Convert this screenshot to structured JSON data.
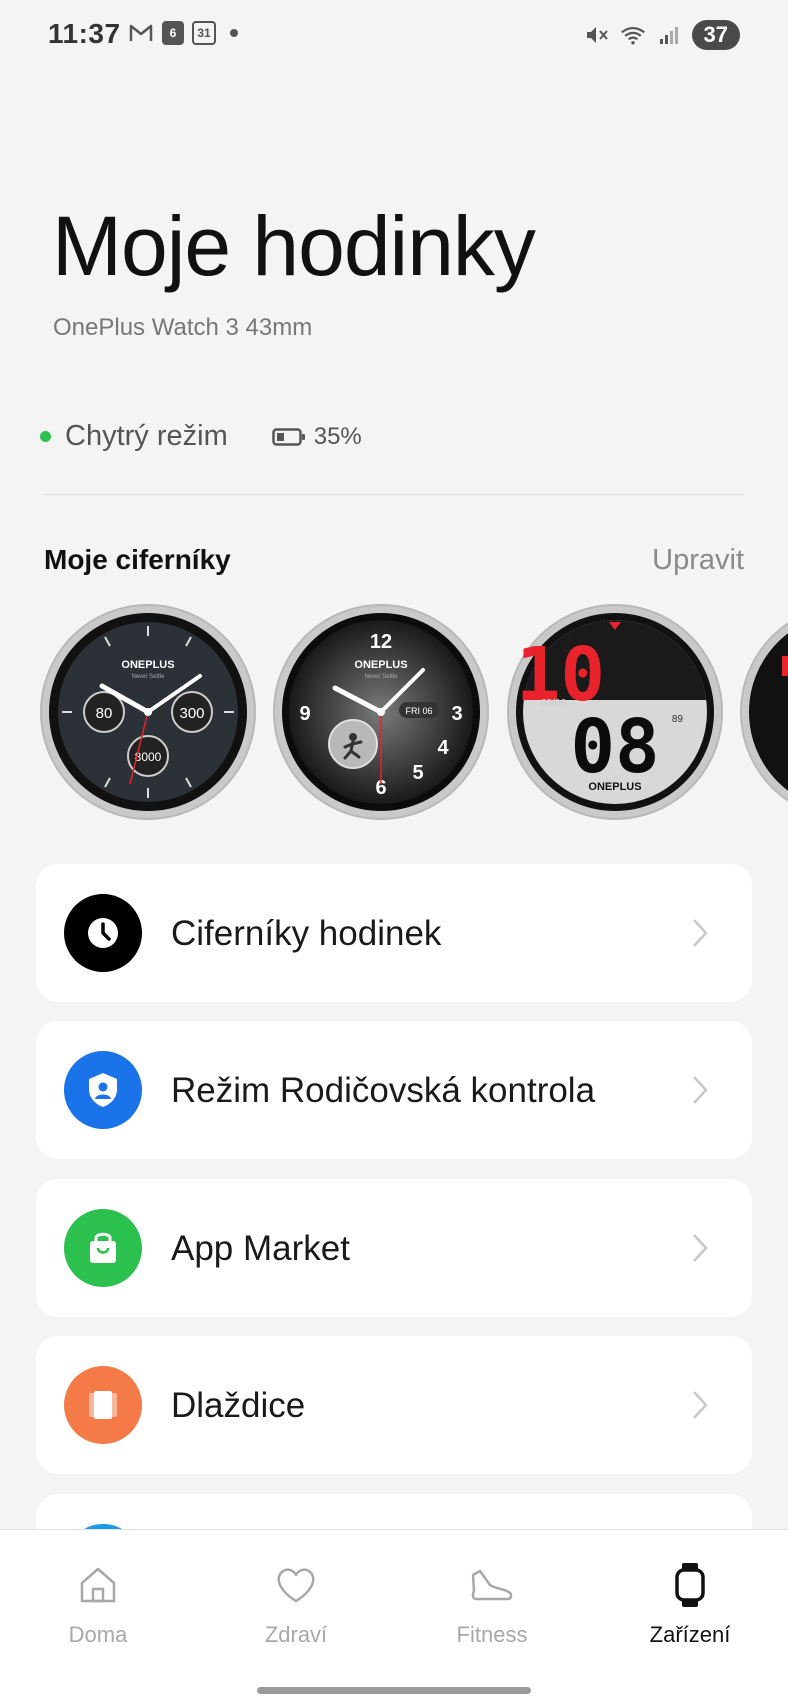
{
  "status_bar": {
    "time": "11:37",
    "badge_count": "6",
    "calendar_day": "31",
    "battery": "37"
  },
  "header": {
    "title": "Moje hodinky",
    "device": "OnePlus Watch 3 43mm"
  },
  "status": {
    "mode": "Chytrý režim",
    "battery": "35%"
  },
  "faces": {
    "title": "Moje ciferníky",
    "edit": "Upravit",
    "items": [
      {
        "brand": "ONEPLUS",
        "tagline": "Never Settle",
        "dial_left": "80",
        "dial_right": "300",
        "dial_bottom": "8000"
      },
      {
        "brand": "ONEPLUS",
        "tagline": "Never Settle",
        "date": "FRI 06",
        "num_12": "12",
        "num_9": "9",
        "num_3": "3",
        "num_4": "4",
        "num_5": "5",
        "num_6": "6"
      },
      {
        "hour": "10",
        "minute": "08",
        "date": "03/06",
        "heart": "89",
        "brand": "ONEPLUS"
      }
    ]
  },
  "menu": [
    {
      "label": "Ciferníky hodinek",
      "icon": "clock-icon",
      "color": "#000000"
    },
    {
      "label": "Režim Rodičovská kontrola",
      "icon": "shield-person-icon",
      "color": "#1a73e8"
    },
    {
      "label": "App Market",
      "icon": "shopping-bag-icon",
      "color": "#2cc04f"
    },
    {
      "label": "Dlaždice",
      "icon": "tiles-icon",
      "color": "#f47a48"
    }
  ],
  "nav": [
    {
      "label": "Doma",
      "icon": "home-icon"
    },
    {
      "label": "Zdraví",
      "icon": "heart-icon"
    },
    {
      "label": "Fitness",
      "icon": "shoe-icon"
    },
    {
      "label": "Zařízení",
      "icon": "watch-icon",
      "active": true
    }
  ],
  "colors": {
    "accent_green": "#2cc04f",
    "accent_red": "#e8232b",
    "background": "#f4f4f4"
  }
}
